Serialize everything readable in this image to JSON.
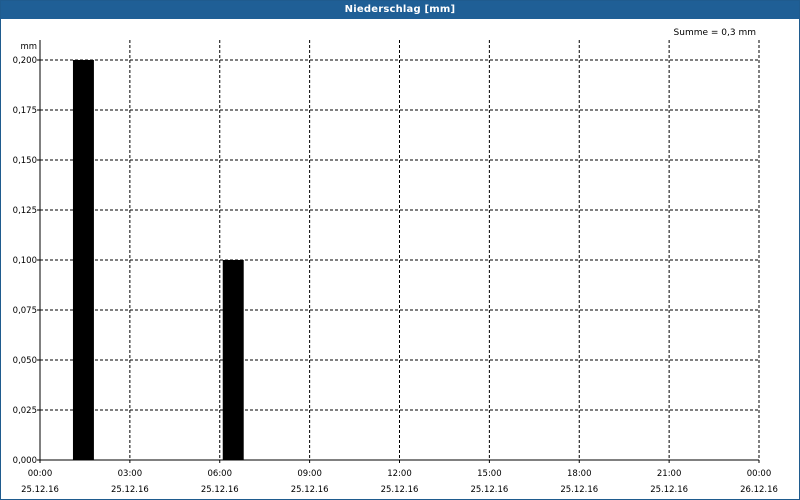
{
  "title": "Niederschlag [mm]",
  "summary": "Summe = 0,3 mm",
  "chart_data": {
    "type": "bar",
    "title": "Niederschlag [mm]",
    "ylabel": "mm",
    "ylim": [
      0,
      0.2
    ],
    "yticks": [
      "0,000",
      "0,025",
      "0,050",
      "0,075",
      "0,100",
      "0,125",
      "0,150",
      "0,175",
      "0,200"
    ],
    "xlim_hours": [
      0,
      24
    ],
    "xticks": [
      {
        "time": "00:00",
        "date": "25.12.16"
      },
      {
        "time": "03:00",
        "date": "25.12.16"
      },
      {
        "time": "06:00",
        "date": "25.12.16"
      },
      {
        "time": "09:00",
        "date": "25.12.16"
      },
      {
        "time": "12:00",
        "date": "25.12.16"
      },
      {
        "time": "15:00",
        "date": "25.12.16"
      },
      {
        "time": "18:00",
        "date": "25.12.16"
      },
      {
        "time": "21:00",
        "date": "25.12.16"
      },
      {
        "time": "00:00",
        "date": "26.12.16"
      }
    ],
    "bars": [
      {
        "start": "25.12.16 01:00",
        "end": "25.12.16 02:00",
        "value": 0.2
      },
      {
        "start": "25.12.16 06:00",
        "end": "25.12.16 07:00",
        "value": 0.1
      }
    ],
    "grid": true,
    "colors": {
      "bar": "#000000",
      "titlebar": "#1f5f96"
    }
  }
}
